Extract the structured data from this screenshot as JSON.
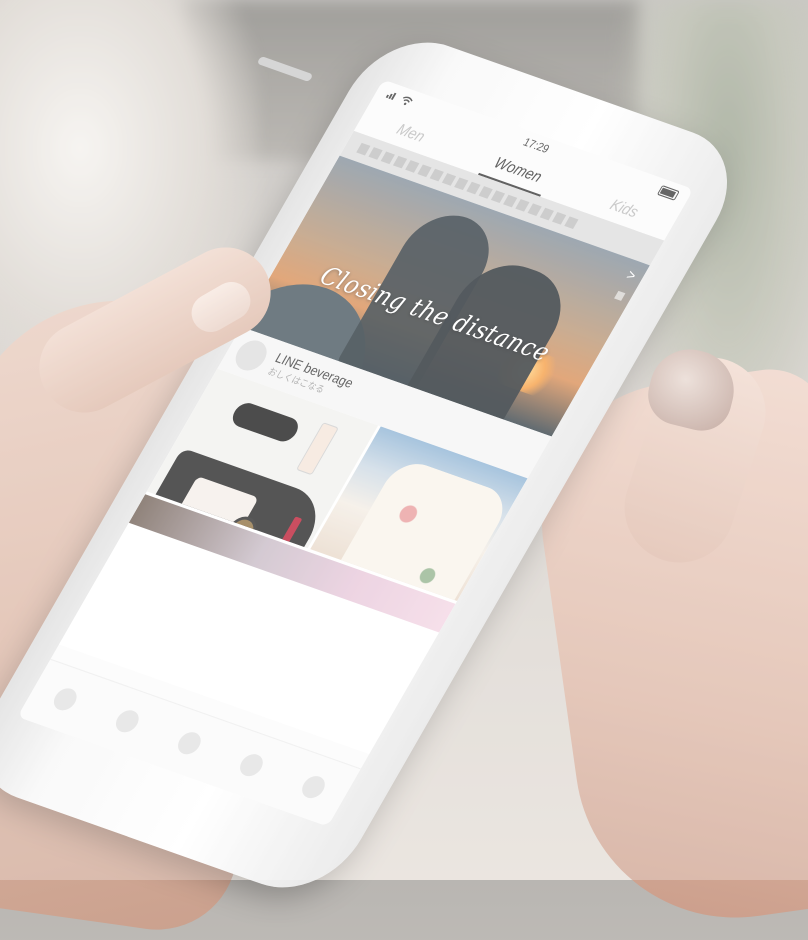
{
  "status_bar": {
    "time": "17:29",
    "signal_icon": "signal-icon",
    "wifi_icon": "wifi-icon",
    "battery_icon": "battery-icon"
  },
  "tabs": [
    {
      "label": "Men",
      "active": false
    },
    {
      "label": "Women",
      "active": true
    },
    {
      "label": "Kids",
      "active": false
    }
  ],
  "hero": {
    "caption": "Closing the distance",
    "arrow": ">"
  },
  "brand": {
    "name": "LINE beverage",
    "subtitle": "おしくはこなる"
  },
  "bottom_nav": {
    "items": [
      "nav-item-1",
      "nav-item-2",
      "nav-item-3",
      "nav-item-4",
      "nav-item-5"
    ]
  },
  "colors": {
    "active_tab": "#2e2e2e",
    "inactive_tab": "#b8b8b8",
    "notice_bar": "#dcdcdc"
  }
}
